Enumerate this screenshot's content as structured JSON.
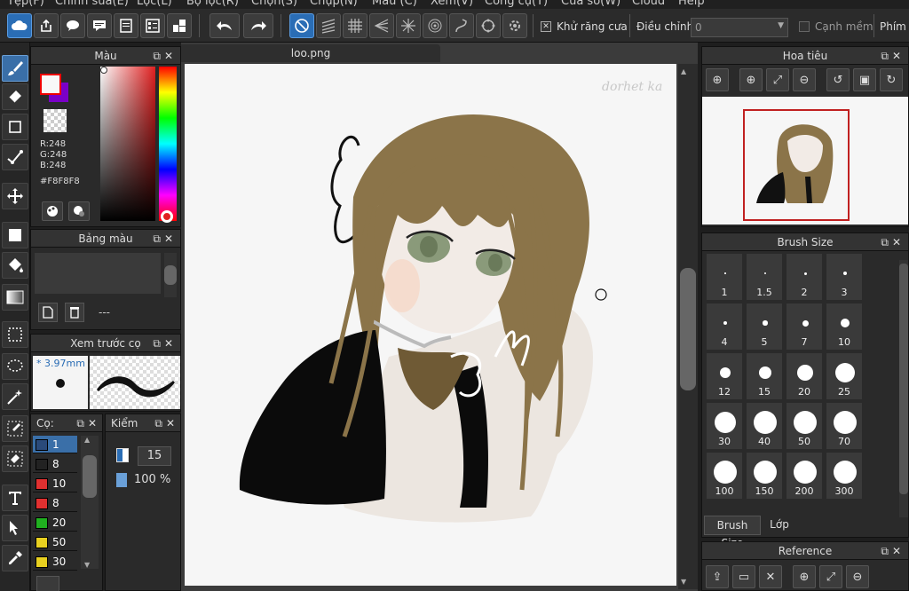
{
  "menu": [
    "Tệp(F)",
    "Chỉnh sửa(E)",
    "Lọc(L)",
    "Bộ lọc(R)",
    "Chọn(S)",
    "Chụp(N)",
    "Màu (C)",
    "Xem(V)",
    "Công cụ(T)",
    "Cửa sổ(W)",
    "Cloud",
    "Help"
  ],
  "toolbar": {
    "antialias_label": "Khử răng cưa",
    "adjust_label": "Điều chỉnh",
    "adjust_value": "0",
    "soft_edge_label": "Cạnh mềm",
    "shortcut_label": "Phím"
  },
  "color_panel": {
    "title": "Màu",
    "r": "R:248",
    "g": "G:248",
    "b": "B:248",
    "hex": "#F8F8F8",
    "primary_color": "#F8F8F8",
    "secondary_color": "#7a00c8",
    "hue_ring": "#e02020"
  },
  "palette_panel": {
    "title": "Bảng màu",
    "footer": "---"
  },
  "brush_preview": {
    "title": "Xem trước cọ",
    "size": "* 3.97mm"
  },
  "brush_list": {
    "title": "Cọ:",
    "items": [
      {
        "value": "1",
        "color": "#2a4a7a",
        "selected": true
      },
      {
        "value": "8",
        "color": "#222222"
      },
      {
        "value": "10",
        "color": "#e03030"
      },
      {
        "value": "8",
        "color": "#e03030"
      },
      {
        "value": "20",
        "color": "#20b020"
      },
      {
        "value": "50",
        "color": "#e8d020"
      },
      {
        "value": "30",
        "color": "#e8d020"
      }
    ]
  },
  "check_panel": {
    "title": "Kiểm",
    "size": "15",
    "opacity": "100 %"
  },
  "document": {
    "tab": "loo.png",
    "signature": "dorhet ka"
  },
  "navigator": {
    "title": "Hoa tiêu"
  },
  "brush_size": {
    "title": "Brush Size",
    "sizes": [
      "1",
      "1.5",
      "2",
      "3",
      "4",
      "5",
      "7",
      "10",
      "12",
      "15",
      "20",
      "25",
      "30",
      "40",
      "50",
      "70",
      "100",
      "150",
      "200",
      "300"
    ],
    "tabs": [
      "Brush Size",
      "Lớp"
    ]
  },
  "reference": {
    "title": "Reference"
  }
}
